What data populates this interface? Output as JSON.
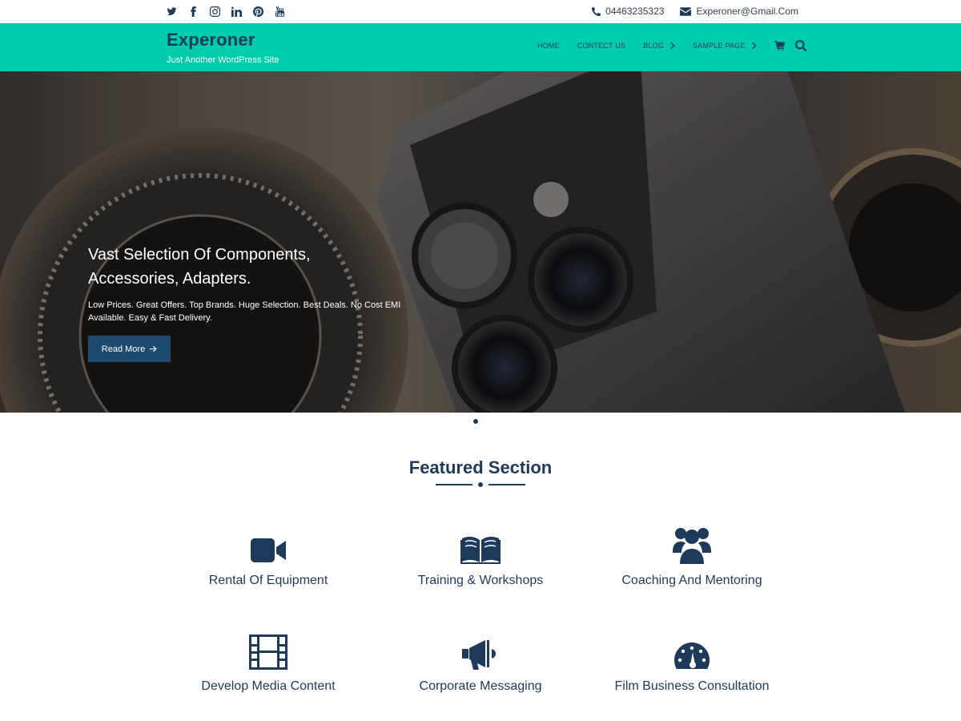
{
  "topbar": {
    "social": [
      "twitter-icon",
      "facebook-icon",
      "instagram-icon",
      "linkedin-icon",
      "pinterest-icon",
      "youtube-icon"
    ],
    "phone": "04463235323",
    "email": "Experoner@Gmail.Com"
  },
  "header": {
    "site_title": "Experoner",
    "tagline": "Just Another WordPress Site",
    "nav": [
      {
        "label": "HOME",
        "has_submenu": false
      },
      {
        "label": "CONTECT US",
        "has_submenu": false
      },
      {
        "label": "BLOG",
        "has_submenu": true
      },
      {
        "label": "SAMPLE PAGE",
        "has_submenu": true
      }
    ],
    "tools": [
      "cart-icon",
      "search-icon"
    ]
  },
  "hero": {
    "title": "Vast Selection Of Components, Accessories, Adapters.",
    "text": "Low Prices. Great Offers. Top Brands. Huge Selection. Best Deals. No Cost EMI Available. Easy & Fast Delivery.",
    "button_label": "Read More"
  },
  "featured": {
    "title": "Featured Section",
    "items": [
      {
        "label": "Rental Of Equipment",
        "icon": "video-camera-icon"
      },
      {
        "label": "Training & Workshops",
        "icon": "open-book-icon"
      },
      {
        "label": "Coaching And Mentoring",
        "icon": "users-group-icon"
      },
      {
        "label": "Develop Media Content",
        "icon": "film-icon"
      },
      {
        "label": "Corporate Messaging",
        "icon": "megaphone-icon"
      },
      {
        "label": "Film Business Consultation",
        "icon": "dashboard-icon"
      }
    ]
  },
  "colors": {
    "accent": "#00cdac",
    "primary": "#1d3a5a",
    "button": "#1d4a6e"
  }
}
